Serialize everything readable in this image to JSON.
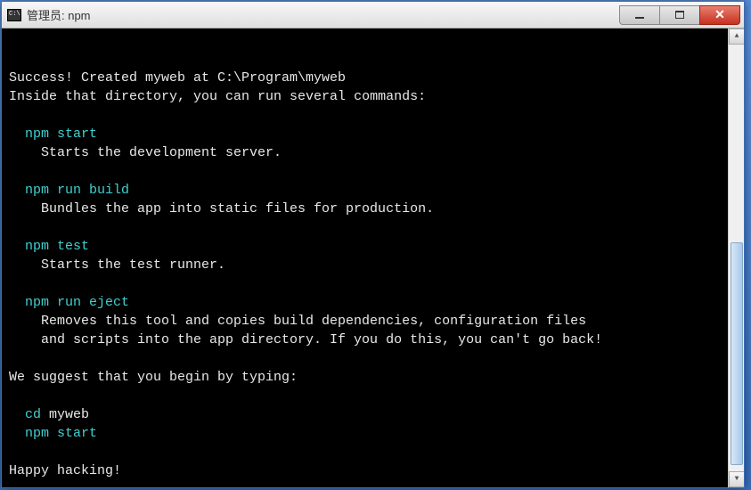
{
  "titlebar": {
    "text": "管理员: npm"
  },
  "terminal": {
    "line1": "Success! Created myweb at C:\\Program\\myweb",
    "line2": "Inside that directory, you can run several commands:",
    "npm_start": "npm start",
    "npm_start_desc": "Starts the development server.",
    "npm_build": "npm run build",
    "npm_build_desc": "Bundles the app into static files for production.",
    "npm_test": "npm test",
    "npm_test_desc": "Starts the test runner.",
    "npm_eject": "npm run eject",
    "npm_eject_desc1": "Removes this tool and copies build dependencies, configuration files",
    "npm_eject_desc2": "and scripts into the app directory. If you do this, you can't go back!",
    "suggest": "We suggest that you begin by typing:",
    "cd_cmd_prefix": "cd ",
    "cd_cmd_arg": "myweb",
    "npm_start2": "npm start",
    "happy": "Happy hacking!"
  }
}
